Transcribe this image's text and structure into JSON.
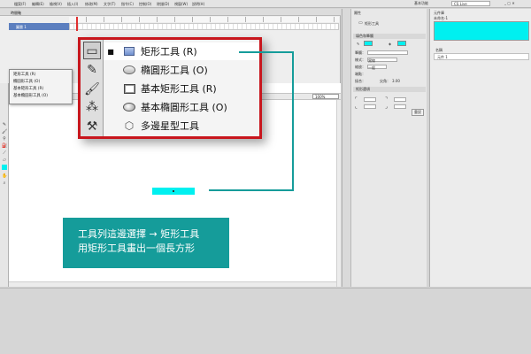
{
  "menubar": {
    "items": [
      "檔案(F)",
      "編輯(E)",
      "檢視(V)",
      "插入(I)",
      "修改(M)",
      "文字(T)",
      "指令(C)",
      "控制(O)",
      "除錯(D)",
      "視窗(W)",
      "說明(H)"
    ],
    "workspace": "基本功能",
    "search_placeholder": "CS Live"
  },
  "timeline": {
    "tab_label": "時間軸",
    "layer_name": "圖層 1"
  },
  "small_flyout": {
    "items": [
      "矩形工具 (R)",
      "橢圓形工具 (O)",
      "基本矩形工具 (R)",
      "基本橢圓形工具 (O)",
      "多邊星型工具"
    ]
  },
  "stage": {
    "zoom": "100%"
  },
  "big_flyout": {
    "items": [
      {
        "label": "矩形工具 (R)",
        "selected": true
      },
      {
        "label": "橢圓形工具 (O)",
        "selected": false
      },
      {
        "label": "基本矩形工具 (R)",
        "selected": false
      },
      {
        "label": "基本橢圓形工具 (O)",
        "selected": false
      },
      {
        "label": "多邊星型工具",
        "selected": false
      }
    ]
  },
  "callout": {
    "line1": "工具列這邊選擇 → 矩形工具",
    "line2": "用矩形工具畫出一個長方形"
  },
  "props": {
    "title": "屬性",
    "tool_name": "矩形工具",
    "section_fill": "填色和筆觸",
    "stroke_label": "筆觸：",
    "style_label": "樣式：",
    "style_value": "實線",
    "scale_label": "縮放：",
    "scale_value": "一般",
    "cap_label": "端點：",
    "join_label": "接合：",
    "miter_label": "尖角：",
    "miter_value": "3.00",
    "section_rect": "矩形選項",
    "reset_label": "重設"
  },
  "library": {
    "title": "元件庫",
    "doc_name": "未命名-1",
    "name_header": "名稱",
    "item": "元件 1"
  },
  "colors": {
    "accent_teal": "#159c9a",
    "fill_cyan": "#00f0f0",
    "highlight_red": "#c8161d"
  }
}
